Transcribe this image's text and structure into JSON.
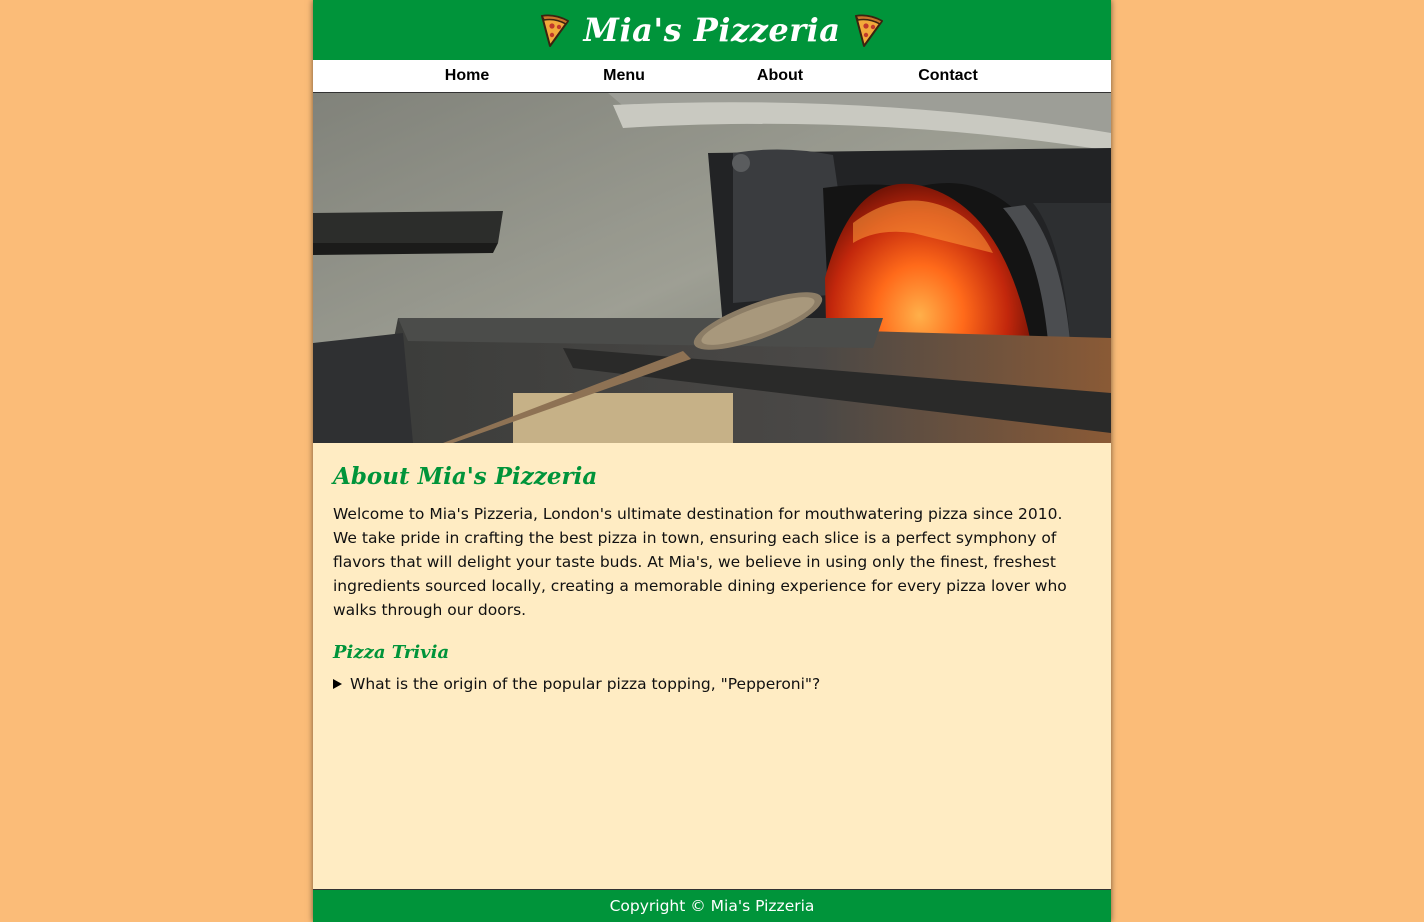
{
  "header": {
    "title": "Mia's Pizzeria",
    "left_icon": "pizza-slice-icon",
    "right_icon": "pizza-slice-icon"
  },
  "nav": {
    "items": [
      {
        "label": "Home"
      },
      {
        "label": "Menu"
      },
      {
        "label": "About"
      },
      {
        "label": "Contact"
      }
    ]
  },
  "hero": {
    "image": "pizza-oven-photo"
  },
  "about": {
    "heading": "About Mia's Pizzeria",
    "text": "Welcome to Mia's Pizzeria, London's ultimate destination for mouthwatering pizza since 2010. We take pride in crafting the best pizza in town, ensuring each slice is a perfect symphony of flavors that will delight your taste buds. At Mia's, we believe in using only the finest, freshest ingredients sourced locally, creating a memorable dining experience for every pizza lover who walks through our doors."
  },
  "trivia": {
    "heading": "Pizza Trivia",
    "question": "What is the origin of the popular pizza topping, \"Pepperoni\"?",
    "expanded": false
  },
  "footer": {
    "copyright": "Copyright © Mia's Pizzeria"
  },
  "colors": {
    "background": "#fbbc78",
    "brand_green": "#00943a",
    "content_bg": "#ffecc3"
  }
}
